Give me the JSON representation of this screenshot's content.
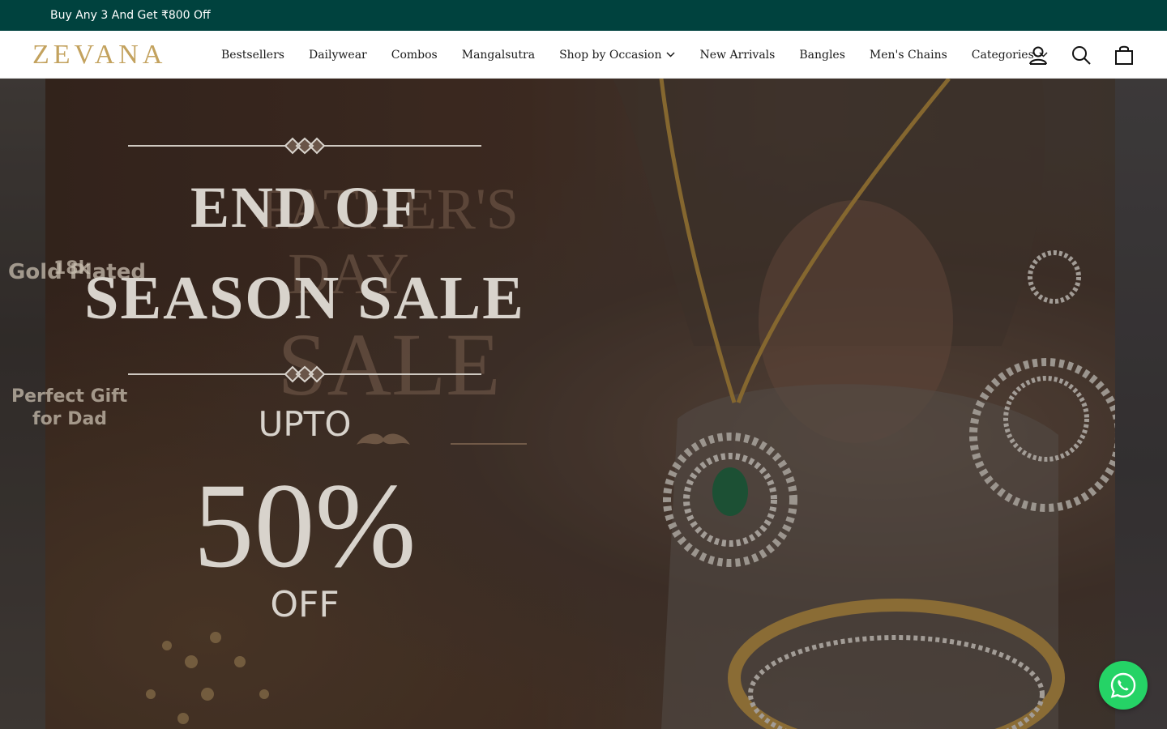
{
  "announcement": {
    "text": "Buy Any 3 And Get ₹800 Off"
  },
  "brand": {
    "logo_text": "ZEVANA",
    "accent": "#c3a25e",
    "bar_color": "#00423e"
  },
  "nav": {
    "items": [
      {
        "label": "Bestsellers",
        "dropdown": false
      },
      {
        "label": "Dailywear",
        "dropdown": false
      },
      {
        "label": "Combos",
        "dropdown": false
      },
      {
        "label": "Mangalsutra",
        "dropdown": false
      },
      {
        "label": "Shop by Occasion",
        "dropdown": true
      },
      {
        "label": "New Arrivals",
        "dropdown": false
      },
      {
        "label": "Bangles",
        "dropdown": false
      },
      {
        "label": "Men's Chains",
        "dropdown": false
      },
      {
        "label": "Categories",
        "dropdown": true
      }
    ]
  },
  "header_icons": [
    "account-icon",
    "search-icon",
    "cart-icon"
  ],
  "hero": {
    "title_line1": "END OF",
    "title_line2": "SEASON SALE",
    "ghost_line1": "FATHER'S",
    "ghost_line2": "DAY",
    "ghost_line3": "SALE",
    "upto": "UPTO",
    "percent": "50%",
    "off": "OFF",
    "left_peek_line1": "18k",
    "left_peek_line2": "Gold Plated",
    "left_peek_line3": "Perfect Gift",
    "left_peek_line4": "for Dad"
  },
  "whatsapp": {
    "icon": "whatsapp-icon",
    "color": "#25d366"
  }
}
